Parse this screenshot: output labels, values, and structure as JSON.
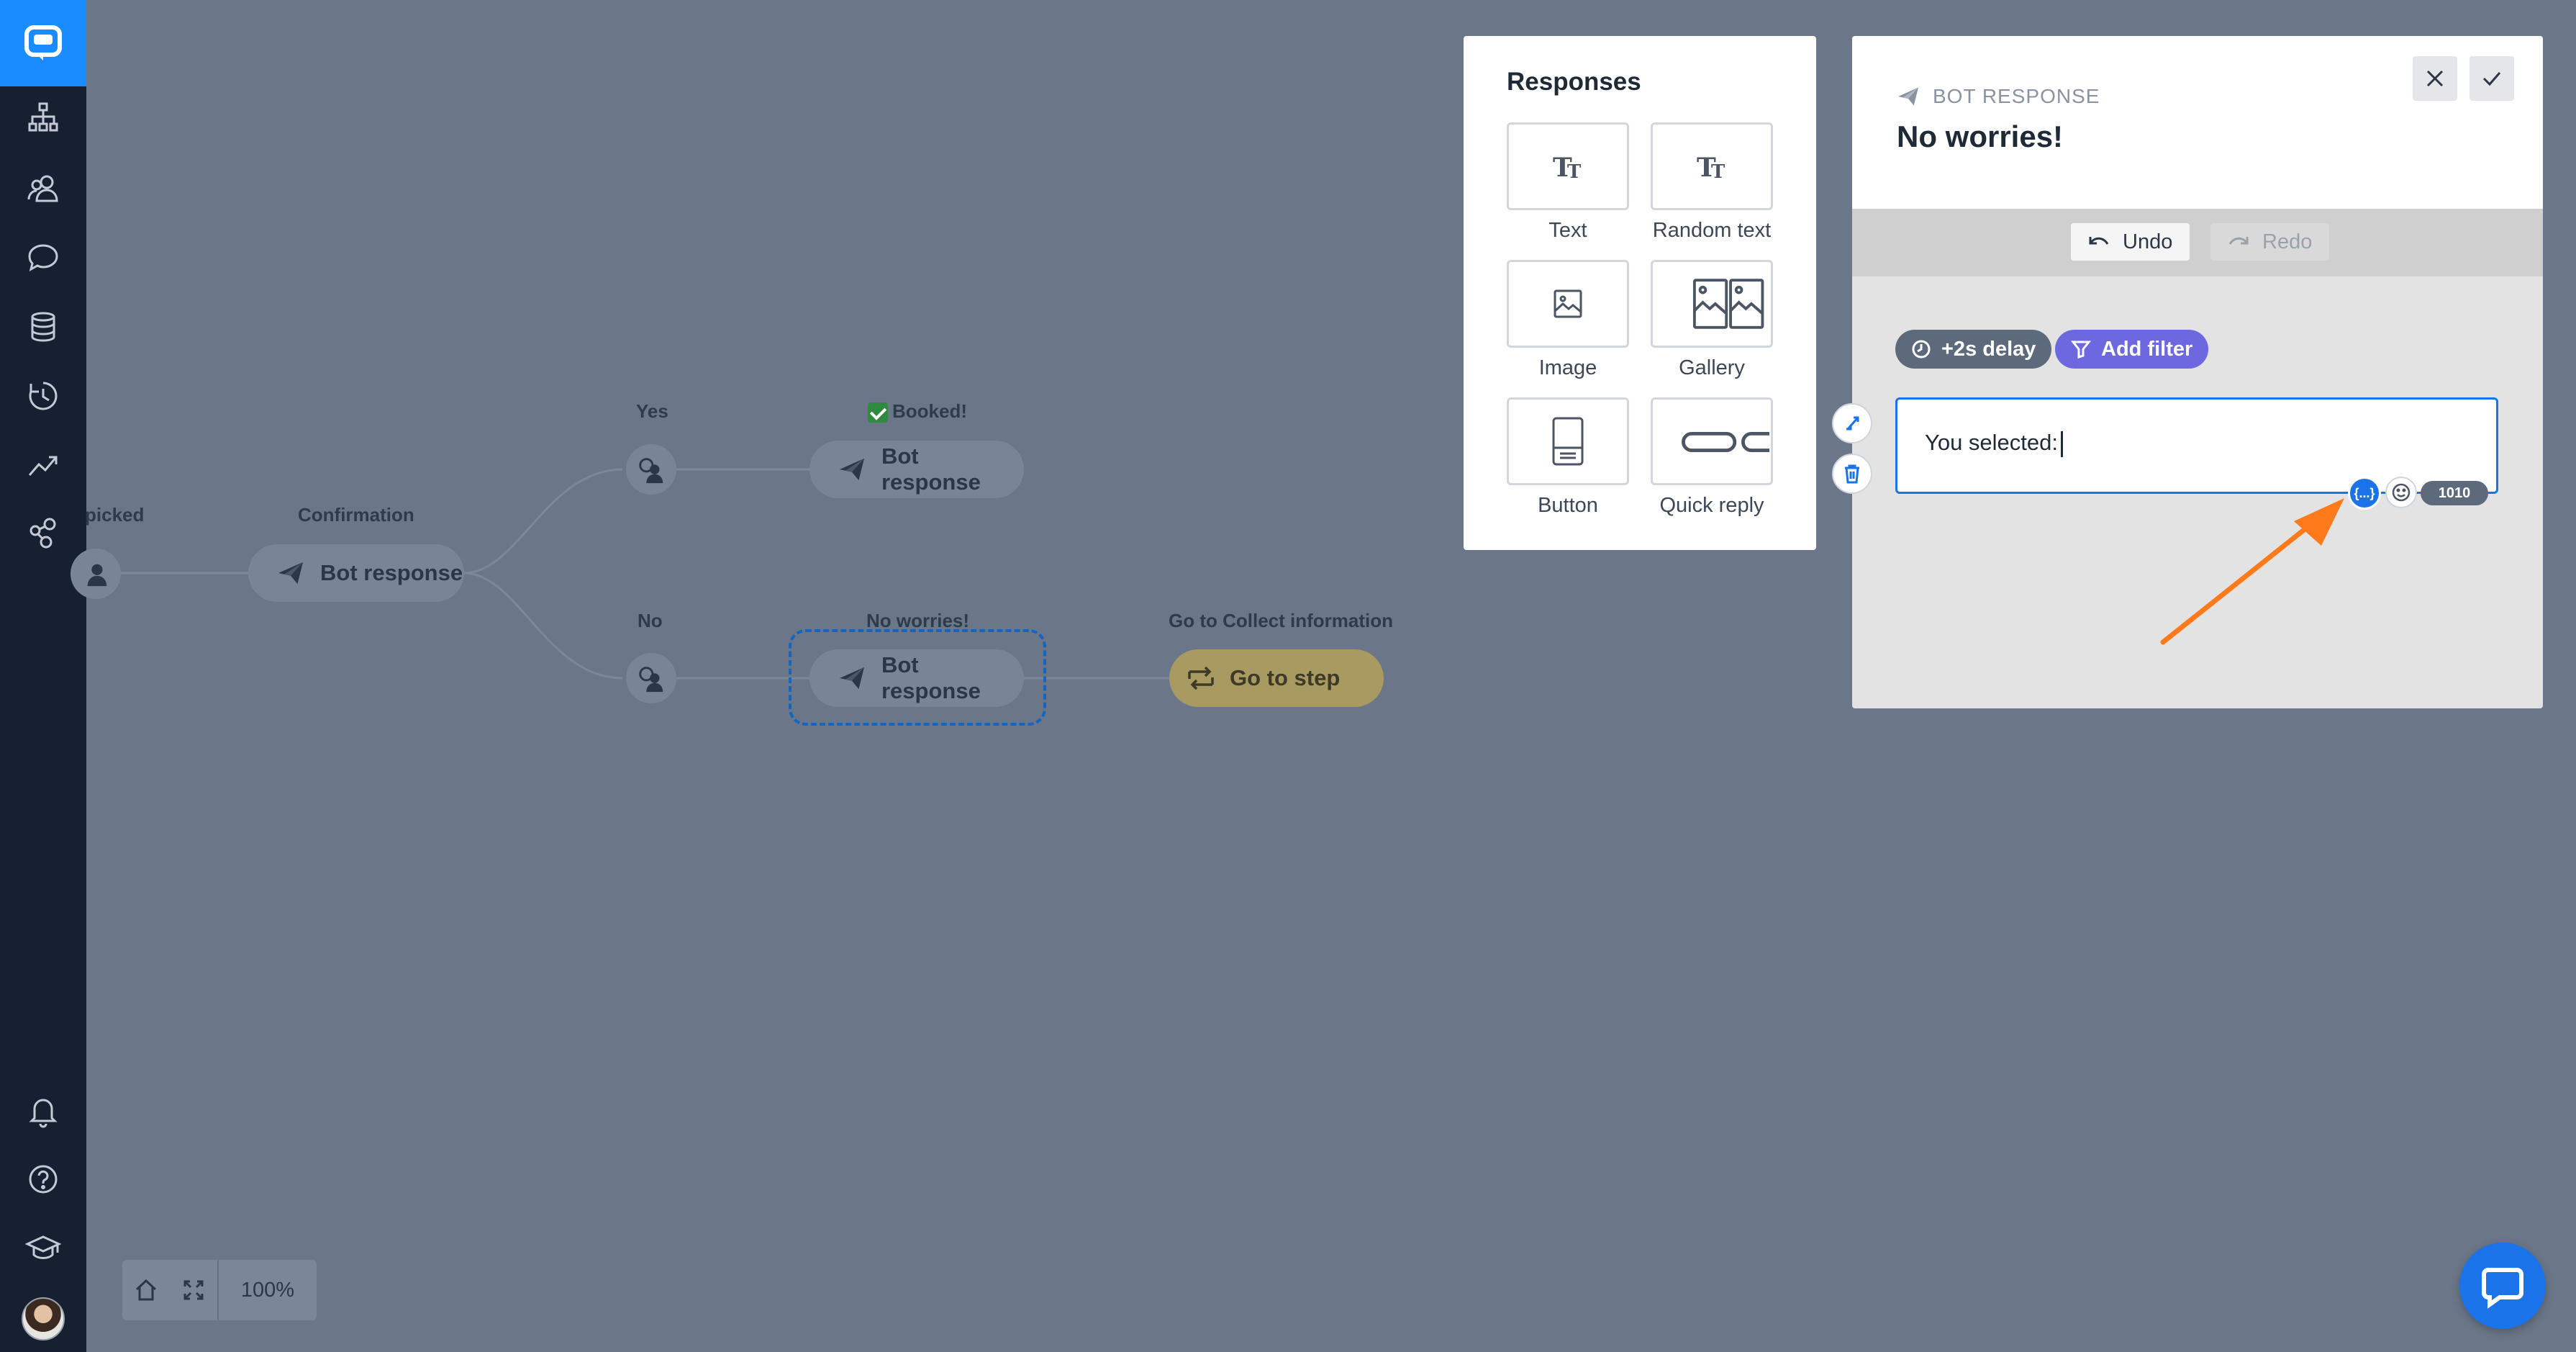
{
  "sidebar": {
    "items": [
      {
        "icon": "chatbots-logo-icon"
      },
      {
        "icon": "stories-icon"
      },
      {
        "icon": "audience-icon"
      },
      {
        "icon": "chat-icon"
      },
      {
        "icon": "database-icon"
      },
      {
        "icon": "history-icon"
      },
      {
        "icon": "reports-icon"
      },
      {
        "icon": "integrations-icon"
      },
      {
        "icon": "bell-icon"
      },
      {
        "icon": "help-icon"
      },
      {
        "icon": "academy-icon"
      }
    ]
  },
  "flow": {
    "left_label": "picked",
    "confirmation_label": "Confirmation",
    "confirmation_node": "Bot response",
    "yes_label": "Yes",
    "no_label": "No",
    "booked_label": "Booked!",
    "booked_node": "Bot response",
    "noworries_label": "No worries!",
    "noworries_node": "Bot response",
    "goto_label": "Go to Collect information",
    "goto_node": "Go to step"
  },
  "zoom": {
    "level": "100%"
  },
  "responses": {
    "title": "Responses",
    "items": [
      {
        "label": "Text",
        "icon": "text-icon"
      },
      {
        "label": "Random text",
        "icon": "random-text-icon"
      },
      {
        "label": "Image",
        "icon": "image-icon"
      },
      {
        "label": "Gallery",
        "icon": "gallery-icon"
      },
      {
        "label": "Button",
        "icon": "button-icon"
      },
      {
        "label": "Quick reply",
        "icon": "quick-reply-icon"
      }
    ]
  },
  "editor": {
    "kind": "BOT RESPONSE",
    "title": "No worries!",
    "undo": "Undo",
    "redo": "Redo",
    "delay_chip": "+2s delay",
    "filter_chip": "Add filter",
    "message_text": "You selected:",
    "variable_button": "{...}",
    "char_counter": "1010"
  },
  "colors": {
    "canvas_bg": "#6b7789",
    "sidebar_bg": "#172031",
    "brand_blue": "#1a8cff",
    "primary_blue": "#1a73e8",
    "filter_purple": "#6d68e0",
    "arrow_orange": "#ff7a1a"
  }
}
